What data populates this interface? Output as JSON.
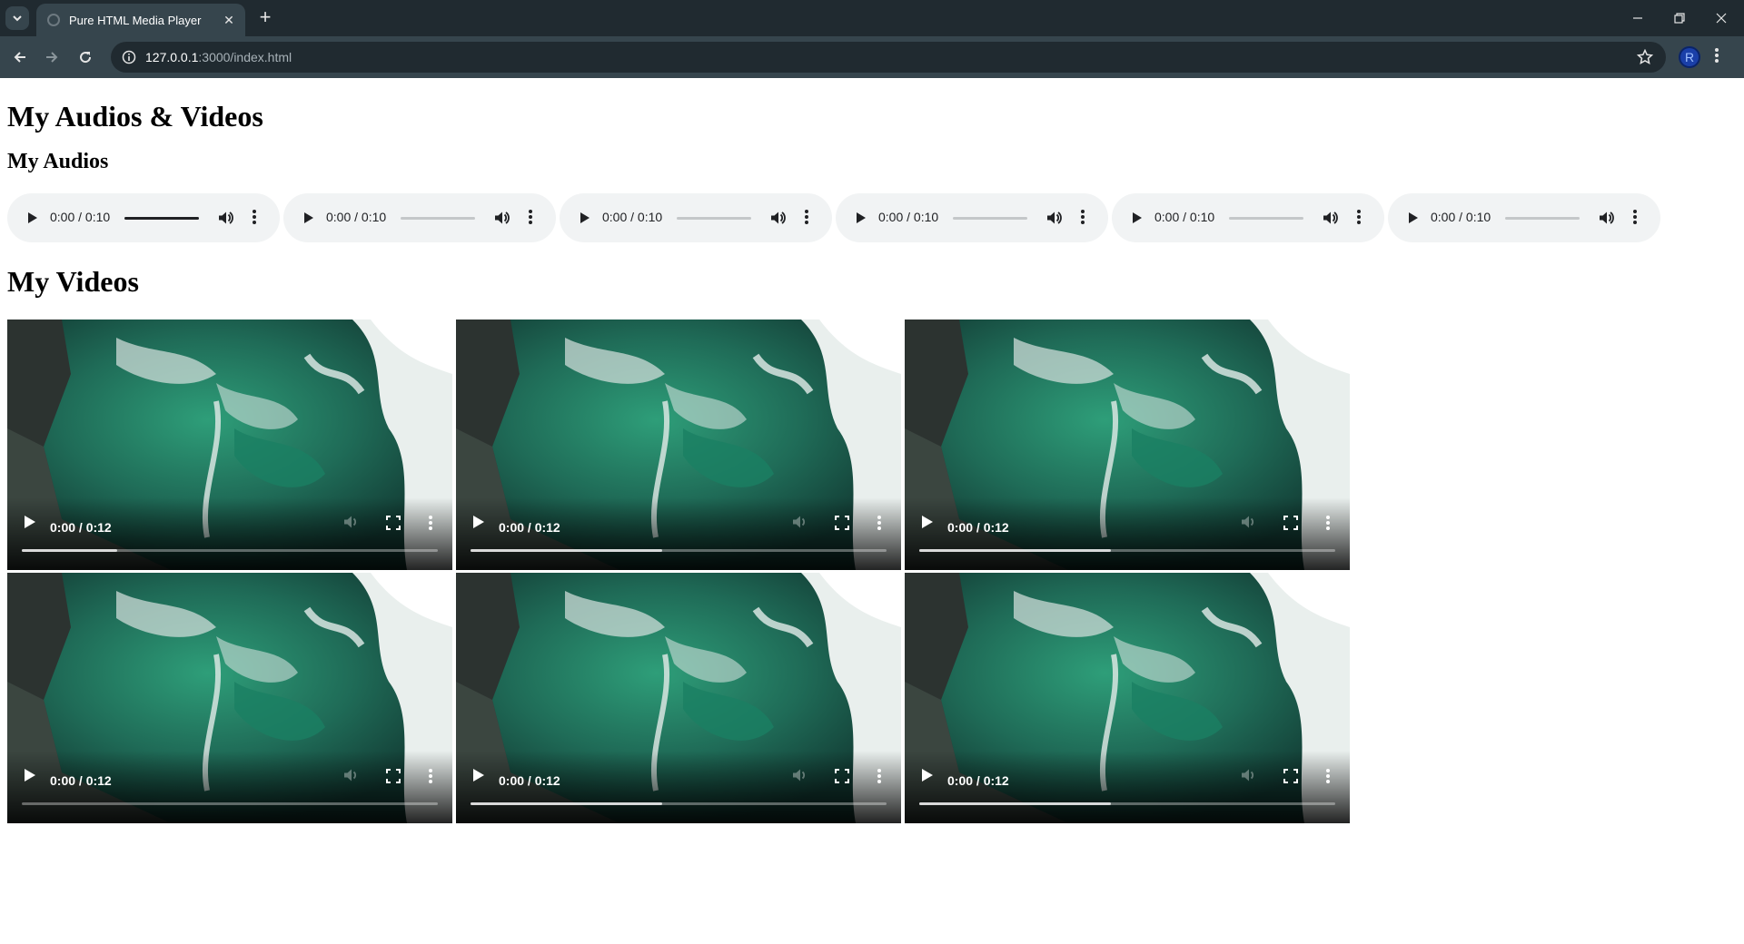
{
  "browser": {
    "tab_title": "Pure HTML Media Player",
    "url_host": "127.0.0.1",
    "url_path": ":3000/index.html",
    "profile_initial": "R"
  },
  "page": {
    "title": "My Audios & Videos",
    "audios_heading": "My Audios",
    "videos_heading": "My Videos"
  },
  "audios": [
    {
      "time": "0:00 / 0:10",
      "volume_level": 1.0
    },
    {
      "time": "0:00 / 0:10",
      "volume_level": 0.0
    },
    {
      "time": "0:00 / 0:10",
      "volume_level": 0.0
    },
    {
      "time": "0:00 / 0:10",
      "volume_level": 0.0
    },
    {
      "time": "0:00 / 0:10",
      "volume_level": 0.0
    },
    {
      "time": "0:00 / 0:10",
      "volume_level": 0.0
    }
  ],
  "videos": [
    {
      "time": "0:00 / 0:12",
      "buffered": 0.23
    },
    {
      "time": "0:00 / 0:12",
      "buffered": 0.46
    },
    {
      "time": "0:00 / 0:12",
      "buffered": 0.46
    },
    {
      "time": "0:00 / 0:12",
      "buffered": 0.0
    },
    {
      "time": "0:00 / 0:12",
      "buffered": 0.46
    },
    {
      "time": "0:00 / 0:12",
      "buffered": 0.46
    }
  ],
  "icons": {
    "play": "play-icon",
    "volume": "volume-icon",
    "more": "more-vertical-icon",
    "fullscreen": "fullscreen-icon"
  }
}
